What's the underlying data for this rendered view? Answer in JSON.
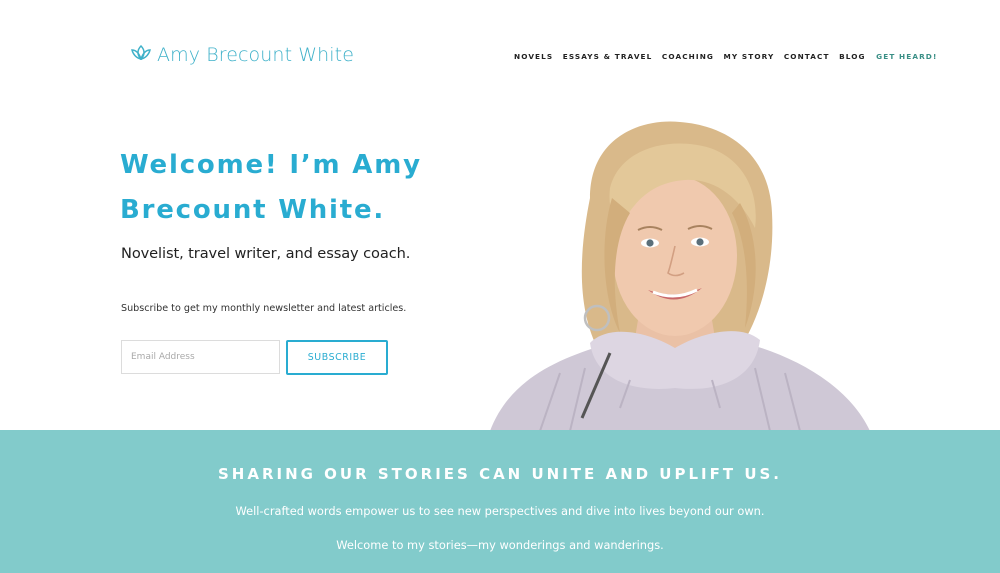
{
  "header": {
    "logo_text": "Amy Brecount White",
    "logo_icon": "lotus-icon",
    "nav": [
      {
        "label": "NOVELS"
      },
      {
        "label": "ESSAYS & TRAVEL"
      },
      {
        "label": "COACHING"
      },
      {
        "label": "MY STORY"
      },
      {
        "label": "CONTACT"
      },
      {
        "label": "BLOG"
      },
      {
        "label": "GET HEARD!"
      }
    ]
  },
  "hero": {
    "title": "Welcome! I’m Amy Brecount White.",
    "tagline": "Novelist, travel writer, and essay coach.",
    "newsletter_text": "Subscribe to get my monthly newsletter and latest articles.",
    "email_placeholder": "Email Address",
    "email_value": "",
    "subscribe_label": "SUBSCRIBE",
    "portrait": "author-portrait"
  },
  "band": {
    "heading": "SHARING OUR STORIES CAN UNITE AND UPLIFT US.",
    "line1": "Well-crafted words empower us to see new perspectives and dive into lives beyond our own.",
    "line2": "Welcome to my stories—my wonderings and wanderings."
  },
  "colors": {
    "accent": "#29acd1",
    "logo": "#3fb1c9",
    "cta": "#3a8f86",
    "band_bg": "#82cbcb",
    "text": "#222222"
  }
}
